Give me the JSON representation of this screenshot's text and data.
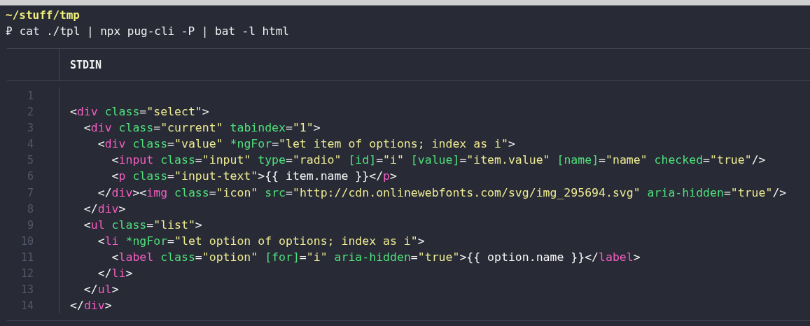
{
  "terminal": {
    "cwd": "~/stuff/tmp",
    "prompt": "₽",
    "command": "cat ./tpl | npx pug-cli -P | bat -l html"
  },
  "viewer": {
    "header": "STDIN",
    "lines": [
      {
        "number": "1"
      },
      {
        "number": "2",
        "tokens": [
          {
            "kind": "punct",
            "text": "<"
          },
          {
            "kind": "tag",
            "text": "div"
          },
          {
            "kind": "attr",
            "text": " class"
          },
          {
            "kind": "punct",
            "text": "="
          },
          {
            "kind": "string",
            "text": "\"select\""
          },
          {
            "kind": "punct",
            "text": ">"
          }
        ]
      },
      {
        "number": "3",
        "tokens": [
          {
            "kind": "punct",
            "text": "  <"
          },
          {
            "kind": "tag",
            "text": "div"
          },
          {
            "kind": "attr",
            "text": " class"
          },
          {
            "kind": "punct",
            "text": "="
          },
          {
            "kind": "string",
            "text": "\"current\""
          },
          {
            "kind": "attr",
            "text": " tabindex"
          },
          {
            "kind": "punct",
            "text": "="
          },
          {
            "kind": "string",
            "text": "\"1\""
          },
          {
            "kind": "punct",
            "text": ">"
          }
        ]
      },
      {
        "number": "4",
        "tokens": [
          {
            "kind": "punct",
            "text": "    <"
          },
          {
            "kind": "tag",
            "text": "div"
          },
          {
            "kind": "attr",
            "text": " class"
          },
          {
            "kind": "punct",
            "text": "="
          },
          {
            "kind": "string",
            "text": "\"value\""
          },
          {
            "kind": "attr",
            "text": " *ngFor"
          },
          {
            "kind": "punct",
            "text": "="
          },
          {
            "kind": "string",
            "text": "\"let item of options; index as i\""
          },
          {
            "kind": "punct",
            "text": ">"
          }
        ]
      },
      {
        "number": "5",
        "tokens": [
          {
            "kind": "punct",
            "text": "      <"
          },
          {
            "kind": "tag",
            "text": "input"
          },
          {
            "kind": "attr",
            "text": " class"
          },
          {
            "kind": "punct",
            "text": "="
          },
          {
            "kind": "string",
            "text": "\"input\""
          },
          {
            "kind": "attr",
            "text": " type"
          },
          {
            "kind": "punct",
            "text": "="
          },
          {
            "kind": "string",
            "text": "\"radio\""
          },
          {
            "kind": "attr",
            "text": " [id]"
          },
          {
            "kind": "punct",
            "text": "="
          },
          {
            "kind": "string",
            "text": "\"i\""
          },
          {
            "kind": "attr",
            "text": " [value]"
          },
          {
            "kind": "punct",
            "text": "="
          },
          {
            "kind": "string",
            "text": "\"item.value\""
          },
          {
            "kind": "attr",
            "text": " [name]"
          },
          {
            "kind": "punct",
            "text": "="
          },
          {
            "kind": "string",
            "text": "\"name\""
          },
          {
            "kind": "attr",
            "text": " checked"
          },
          {
            "kind": "punct",
            "text": "="
          },
          {
            "kind": "string",
            "text": "\"true\""
          },
          {
            "kind": "punct",
            "text": "/>"
          }
        ]
      },
      {
        "number": "6",
        "tokens": [
          {
            "kind": "punct",
            "text": "      <"
          },
          {
            "kind": "tag",
            "text": "p"
          },
          {
            "kind": "attr",
            "text": " class"
          },
          {
            "kind": "punct",
            "text": "="
          },
          {
            "kind": "string",
            "text": "\"input-text\""
          },
          {
            "kind": "punct",
            "text": ">{{ item.name }}</"
          },
          {
            "kind": "tag",
            "text": "p"
          },
          {
            "kind": "punct",
            "text": ">"
          }
        ]
      },
      {
        "number": "7",
        "tokens": [
          {
            "kind": "punct",
            "text": "    </"
          },
          {
            "kind": "tag",
            "text": "div"
          },
          {
            "kind": "punct",
            "text": "><"
          },
          {
            "kind": "tag",
            "text": "img"
          },
          {
            "kind": "attr",
            "text": " class"
          },
          {
            "kind": "punct",
            "text": "="
          },
          {
            "kind": "string",
            "text": "\"icon\""
          },
          {
            "kind": "attr",
            "text": " src"
          },
          {
            "kind": "punct",
            "text": "="
          },
          {
            "kind": "string",
            "text": "\"http://cdn.onlinewebfonts.com/svg/img_295694.svg\""
          },
          {
            "kind": "attr",
            "text": " aria-hidden"
          },
          {
            "kind": "punct",
            "text": "="
          },
          {
            "kind": "string",
            "text": "\"true\""
          },
          {
            "kind": "punct",
            "text": "/>"
          }
        ]
      },
      {
        "number": "8",
        "tokens": [
          {
            "kind": "punct",
            "text": "  </"
          },
          {
            "kind": "tag",
            "text": "div"
          },
          {
            "kind": "punct",
            "text": ">"
          }
        ]
      },
      {
        "number": "9",
        "tokens": [
          {
            "kind": "punct",
            "text": "  <"
          },
          {
            "kind": "tag",
            "text": "ul"
          },
          {
            "kind": "attr",
            "text": " class"
          },
          {
            "kind": "punct",
            "text": "="
          },
          {
            "kind": "string",
            "text": "\"list\""
          },
          {
            "kind": "punct",
            "text": ">"
          }
        ]
      },
      {
        "number": "10",
        "tokens": [
          {
            "kind": "punct",
            "text": "    <"
          },
          {
            "kind": "tag",
            "text": "li"
          },
          {
            "kind": "attr",
            "text": " *ngFor"
          },
          {
            "kind": "punct",
            "text": "="
          },
          {
            "kind": "string",
            "text": "\"let option of options; index as i\""
          },
          {
            "kind": "punct",
            "text": ">"
          }
        ]
      },
      {
        "number": "11",
        "tokens": [
          {
            "kind": "punct",
            "text": "      <"
          },
          {
            "kind": "tag",
            "text": "label"
          },
          {
            "kind": "attr",
            "text": " class"
          },
          {
            "kind": "punct",
            "text": "="
          },
          {
            "kind": "string",
            "text": "\"option\""
          },
          {
            "kind": "attr",
            "text": " [for]"
          },
          {
            "kind": "punct",
            "text": "="
          },
          {
            "kind": "string",
            "text": "\"i\""
          },
          {
            "kind": "attr",
            "text": " aria-hidden"
          },
          {
            "kind": "punct",
            "text": "="
          },
          {
            "kind": "string",
            "text": "\"true\""
          },
          {
            "kind": "punct",
            "text": ">{{ option.name }}</"
          },
          {
            "kind": "tag",
            "text": "label"
          },
          {
            "kind": "punct",
            "text": ">"
          }
        ]
      },
      {
        "number": "12",
        "tokens": [
          {
            "kind": "punct",
            "text": "    </"
          },
          {
            "kind": "tag",
            "text": "li"
          },
          {
            "kind": "punct",
            "text": ">"
          }
        ]
      },
      {
        "number": "13",
        "tokens": [
          {
            "kind": "punct",
            "text": "  </"
          },
          {
            "kind": "tag",
            "text": "ul"
          },
          {
            "kind": "punct",
            "text": ">"
          }
        ]
      },
      {
        "number": "14",
        "tokens": [
          {
            "kind": "punct",
            "text": "</"
          },
          {
            "kind": "tag",
            "text": "div"
          },
          {
            "kind": "punct",
            "text": ">"
          }
        ]
      }
    ]
  }
}
